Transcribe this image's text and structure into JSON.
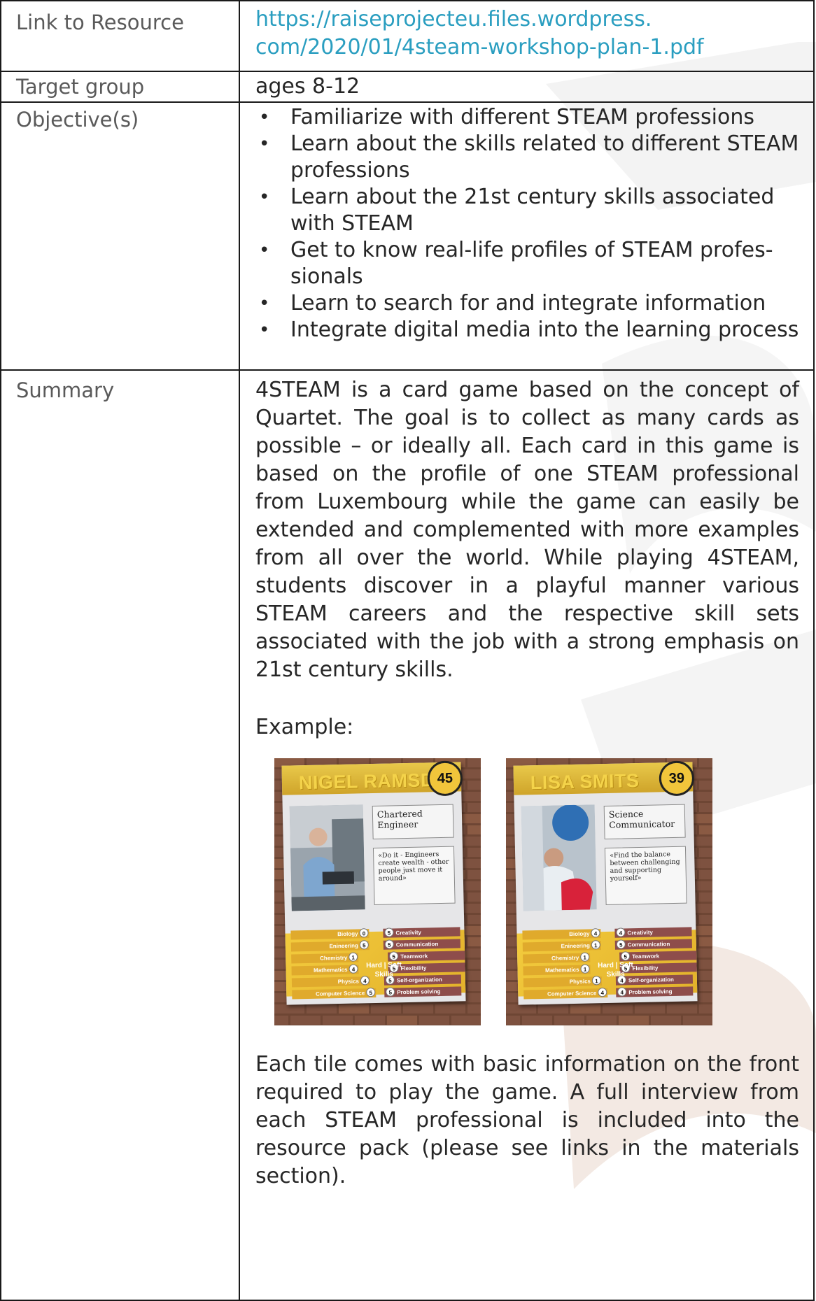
{
  "rows": {
    "link": {
      "label": "Link to Resource",
      "line1": "https://raiseprojecteu.files.wordpress.",
      "line2": "com/2020/01/4steam-workshop-plan-1.pdf"
    },
    "target": {
      "label": "Target group",
      "value": "ages 8-12"
    },
    "objectives": {
      "label": "Objective(s)",
      "items": [
        "Familiarize with different STEAM professions",
        "Learn about the skills related to different STEAM professions",
        "Learn about the 21st century skills associated with STEAM",
        "Get to know real-life profiles of STEAM profes-sionals",
        "Learn to search for and integrate information",
        "Integrate digital media into the learning process"
      ]
    },
    "summary": {
      "label": "Summary",
      "paragraph": "4STEAM is a card game based on the concept of Quartet. The goal is to collect as many cards as possible – or ideally all. Each card in this game is based on the profile of one STEAM professional from Luxembourg while the game can easily be extended and complemented with more examples from all over the world. While playing 4STEAM, students discover in a playful manner various STEAM careers and the respective skill sets associated with the job with a strong emphasis on 21st century skills.",
      "example_label": "Example:",
      "after": "Each tile comes with basic information on the front required to play the game. A full interview from each STEAM professional is included into the resource pack (please see links in the materials section)."
    }
  },
  "cards": [
    {
      "name": "NIGEL RAMSDEN",
      "number": "45",
      "role": "Chartered Engineer",
      "quote": "«Do it - Engineers create wealth - other people just move it around»",
      "hard": [
        [
          "Biology",
          "0"
        ],
        [
          "Enineering",
          "5"
        ],
        [
          "Chemistry",
          "1"
        ],
        [
          "Mathematics",
          "4"
        ],
        [
          "Physics",
          "4"
        ],
        [
          "Computer Science",
          "5"
        ]
      ],
      "soft": [
        [
          "Creativity",
          "5"
        ],
        [
          "Communication",
          "5"
        ],
        [
          "Teamwork",
          "5"
        ],
        [
          "Flexibility",
          "5"
        ],
        [
          "Self-organization",
          "5"
        ],
        [
          "Problem solving",
          "5"
        ]
      ],
      "hard_soft": "Hard | Soft",
      "skills": "Skills"
    },
    {
      "name": "LISA SMITS",
      "number": "39",
      "role": "Science Communicator",
      "quote": "«Find the balance between challenging and supporting yourself»",
      "hard": [
        [
          "Biology",
          "4"
        ],
        [
          "Enineering",
          "1"
        ],
        [
          "Chemistry",
          "1"
        ],
        [
          "Mathematics",
          "1"
        ],
        [
          "Physics",
          "1"
        ],
        [
          "Computer Science",
          "4"
        ]
      ],
      "soft": [
        [
          "Creativity",
          "4"
        ],
        [
          "Communication",
          "5"
        ],
        [
          "Teamwork",
          "5"
        ],
        [
          "Flexibility",
          "5"
        ],
        [
          "Self-organization",
          "4"
        ],
        [
          "Problem solving",
          "4"
        ]
      ],
      "hard_soft": "Hard | Soft",
      "skills": "Skills"
    }
  ],
  "colors": {
    "link": "#2a9ec0",
    "label": "#5a5a5a",
    "text": "#262626",
    "card_yellow": "#f1c53b",
    "card_brown": "#8e4d4b"
  }
}
